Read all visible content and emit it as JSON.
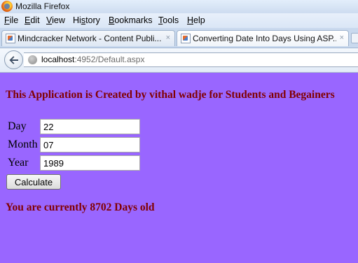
{
  "window": {
    "title": "Mozilla Firefox"
  },
  "menu": [
    {
      "accel": "F",
      "rest": "ile"
    },
    {
      "accel": "E",
      "rest": "dit"
    },
    {
      "accel": "V",
      "rest": "iew"
    },
    {
      "prefix": "Hi",
      "accel": "s",
      "rest": "tory"
    },
    {
      "accel": "B",
      "rest": "ookmarks"
    },
    {
      "accel": "T",
      "rest": "ools"
    },
    {
      "accel": "H",
      "rest": "elp"
    }
  ],
  "tabs": [
    {
      "label": "Mindcracker Network - Content Publi...",
      "close": "×"
    },
    {
      "label": "Converting Date Into Days Using ASP....",
      "close": "×"
    }
  ],
  "address": {
    "host": "localhost",
    "rest": ":4952/Default.aspx"
  },
  "page": {
    "heading": "This Application is Created by vithal wadje for Students and Begainers",
    "fields": [
      {
        "label": "Day",
        "value": "22"
      },
      {
        "label": "Month",
        "value": "07"
      },
      {
        "label": "Year",
        "value": "1989"
      }
    ],
    "button": "Calculate",
    "result": "You are currently 8702 Days old"
  }
}
